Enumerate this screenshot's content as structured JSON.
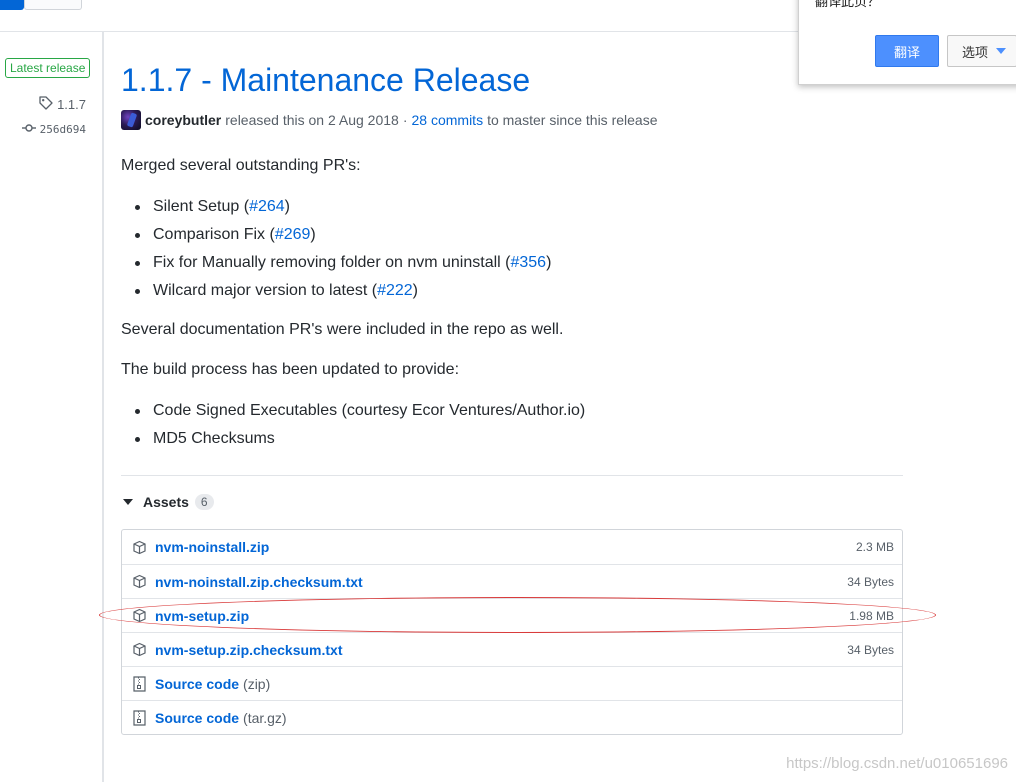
{
  "left": {
    "latest_badge": "Latest release",
    "tag": "1.1.7",
    "commit": "256d694"
  },
  "release": {
    "title": "1.1.7 - Maintenance Release",
    "author": "coreybutler",
    "released_text": "released this on 2 Aug 2018",
    "separator": "·",
    "commits_link": "28 commits",
    "commits_suffix": "to master since this release"
  },
  "body": {
    "intro": "Merged several outstanding PR's:",
    "pr_items": [
      {
        "text": "Silent Setup (",
        "ref": "#264",
        "close": ")"
      },
      {
        "text": "Comparison Fix (",
        "ref": "#269",
        "close": ")"
      },
      {
        "text": "Fix for Manually removing folder on nvm uninstall (",
        "ref": "#356",
        "close": ")"
      },
      {
        "text": "Wilcard major version to latest (",
        "ref": "#222",
        "close": ")"
      }
    ],
    "docs_note": "Several documentation PR's were included in the repo as well.",
    "build_intro": "The build process has been updated to provide:",
    "build_items": [
      "Code Signed Executables (courtesy Ecor Ventures/Author.io)",
      "MD5 Checksums"
    ]
  },
  "assets": {
    "label": "Assets",
    "count": "6",
    "files": [
      {
        "name": "nvm-noinstall.zip",
        "size": "2.3 MB"
      },
      {
        "name": "nvm-noinstall.zip.checksum.txt",
        "size": "34 Bytes"
      },
      {
        "name": "nvm-setup.zip",
        "size": "1.98 MB"
      },
      {
        "name": "nvm-setup.zip.checksum.txt",
        "size": "34 Bytes"
      }
    ],
    "source": [
      {
        "name": "Source code",
        "format": "(zip)"
      },
      {
        "name": "Source code",
        "format": "(tar.gz)"
      }
    ]
  },
  "translate_popup": {
    "title": "翻译此页？",
    "translate_button": "翻译",
    "options_button": "选项"
  },
  "watermark": "https://blog.csdn.net/u010651696",
  "colors": {
    "link": "#0366d6",
    "badge_green": "#28a745",
    "annotation_red": "#d93b3b",
    "translate_blue": "#4d90fe"
  }
}
